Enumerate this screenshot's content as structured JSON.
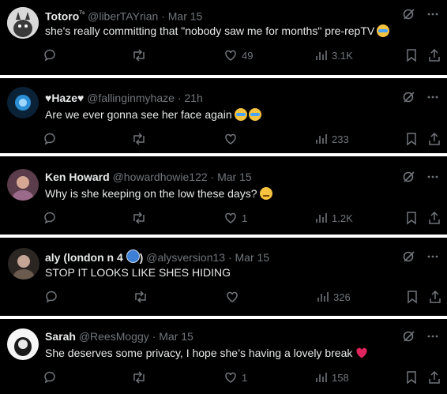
{
  "tweets": [
    {
      "name": "Totoro",
      "name_badge": "ᵀˢ",
      "handle": "@liberTAYrian",
      "dot": "·",
      "date": "Mar 15",
      "text": "she's really committing that \"nobody saw me for months\" pre-repTV",
      "emoji": [
        "loudly-crying-face"
      ],
      "likes": "49",
      "views": "3.1K",
      "avatar_color": "#cfcfcf"
    },
    {
      "name": "♥Haze♥",
      "name_badge": "",
      "handle": "@fallinginmyhaze",
      "dot": "·",
      "date": "21h",
      "text": "Are we ever gonna see her face again",
      "emoji": [
        "loudly-crying-face",
        "loudly-crying-face"
      ],
      "likes": "",
      "views": "233",
      "avatar_color": "#1b6fa8"
    },
    {
      "name": "Ken Howard",
      "name_badge": "",
      "handle": "@howardhowie122",
      "dot": "·",
      "date": "Mar 15",
      "text": "Why is she keeping on the low these days?",
      "emoji": [
        "unamused-face"
      ],
      "likes": "1",
      "views": "1.2K",
      "avatar_color": "#b67a6a"
    },
    {
      "name": "aly (london n 4",
      "name_badge": ")",
      "handle": "@alysversion13",
      "dot": "·",
      "date": "Mar 15",
      "text": "STOP IT LOOKS LIKE SHES HIDING",
      "emoji": [],
      "likes": "",
      "views": "326",
      "avatar_color": "#8a7a6e"
    },
    {
      "name": "Sarah",
      "name_badge": "",
      "handle": "@ReesMoggy",
      "dot": "·",
      "date": "Mar 15",
      "text": "She deserves some privacy, I hope she’s having a lovely break",
      "emoji": [
        "red-heart"
      ],
      "likes": "1",
      "views": "158",
      "avatar_color": "#f2f2f2"
    }
  ],
  "colors": {
    "background": "#000000",
    "separator": "#ffffff",
    "text": "#e7e9ea",
    "secondary": "#71767b"
  },
  "icons": [
    "reply-icon",
    "retweet-icon",
    "like-icon",
    "views-icon",
    "bookmark-icon",
    "share-icon",
    "grok-icon",
    "more-icon"
  ]
}
